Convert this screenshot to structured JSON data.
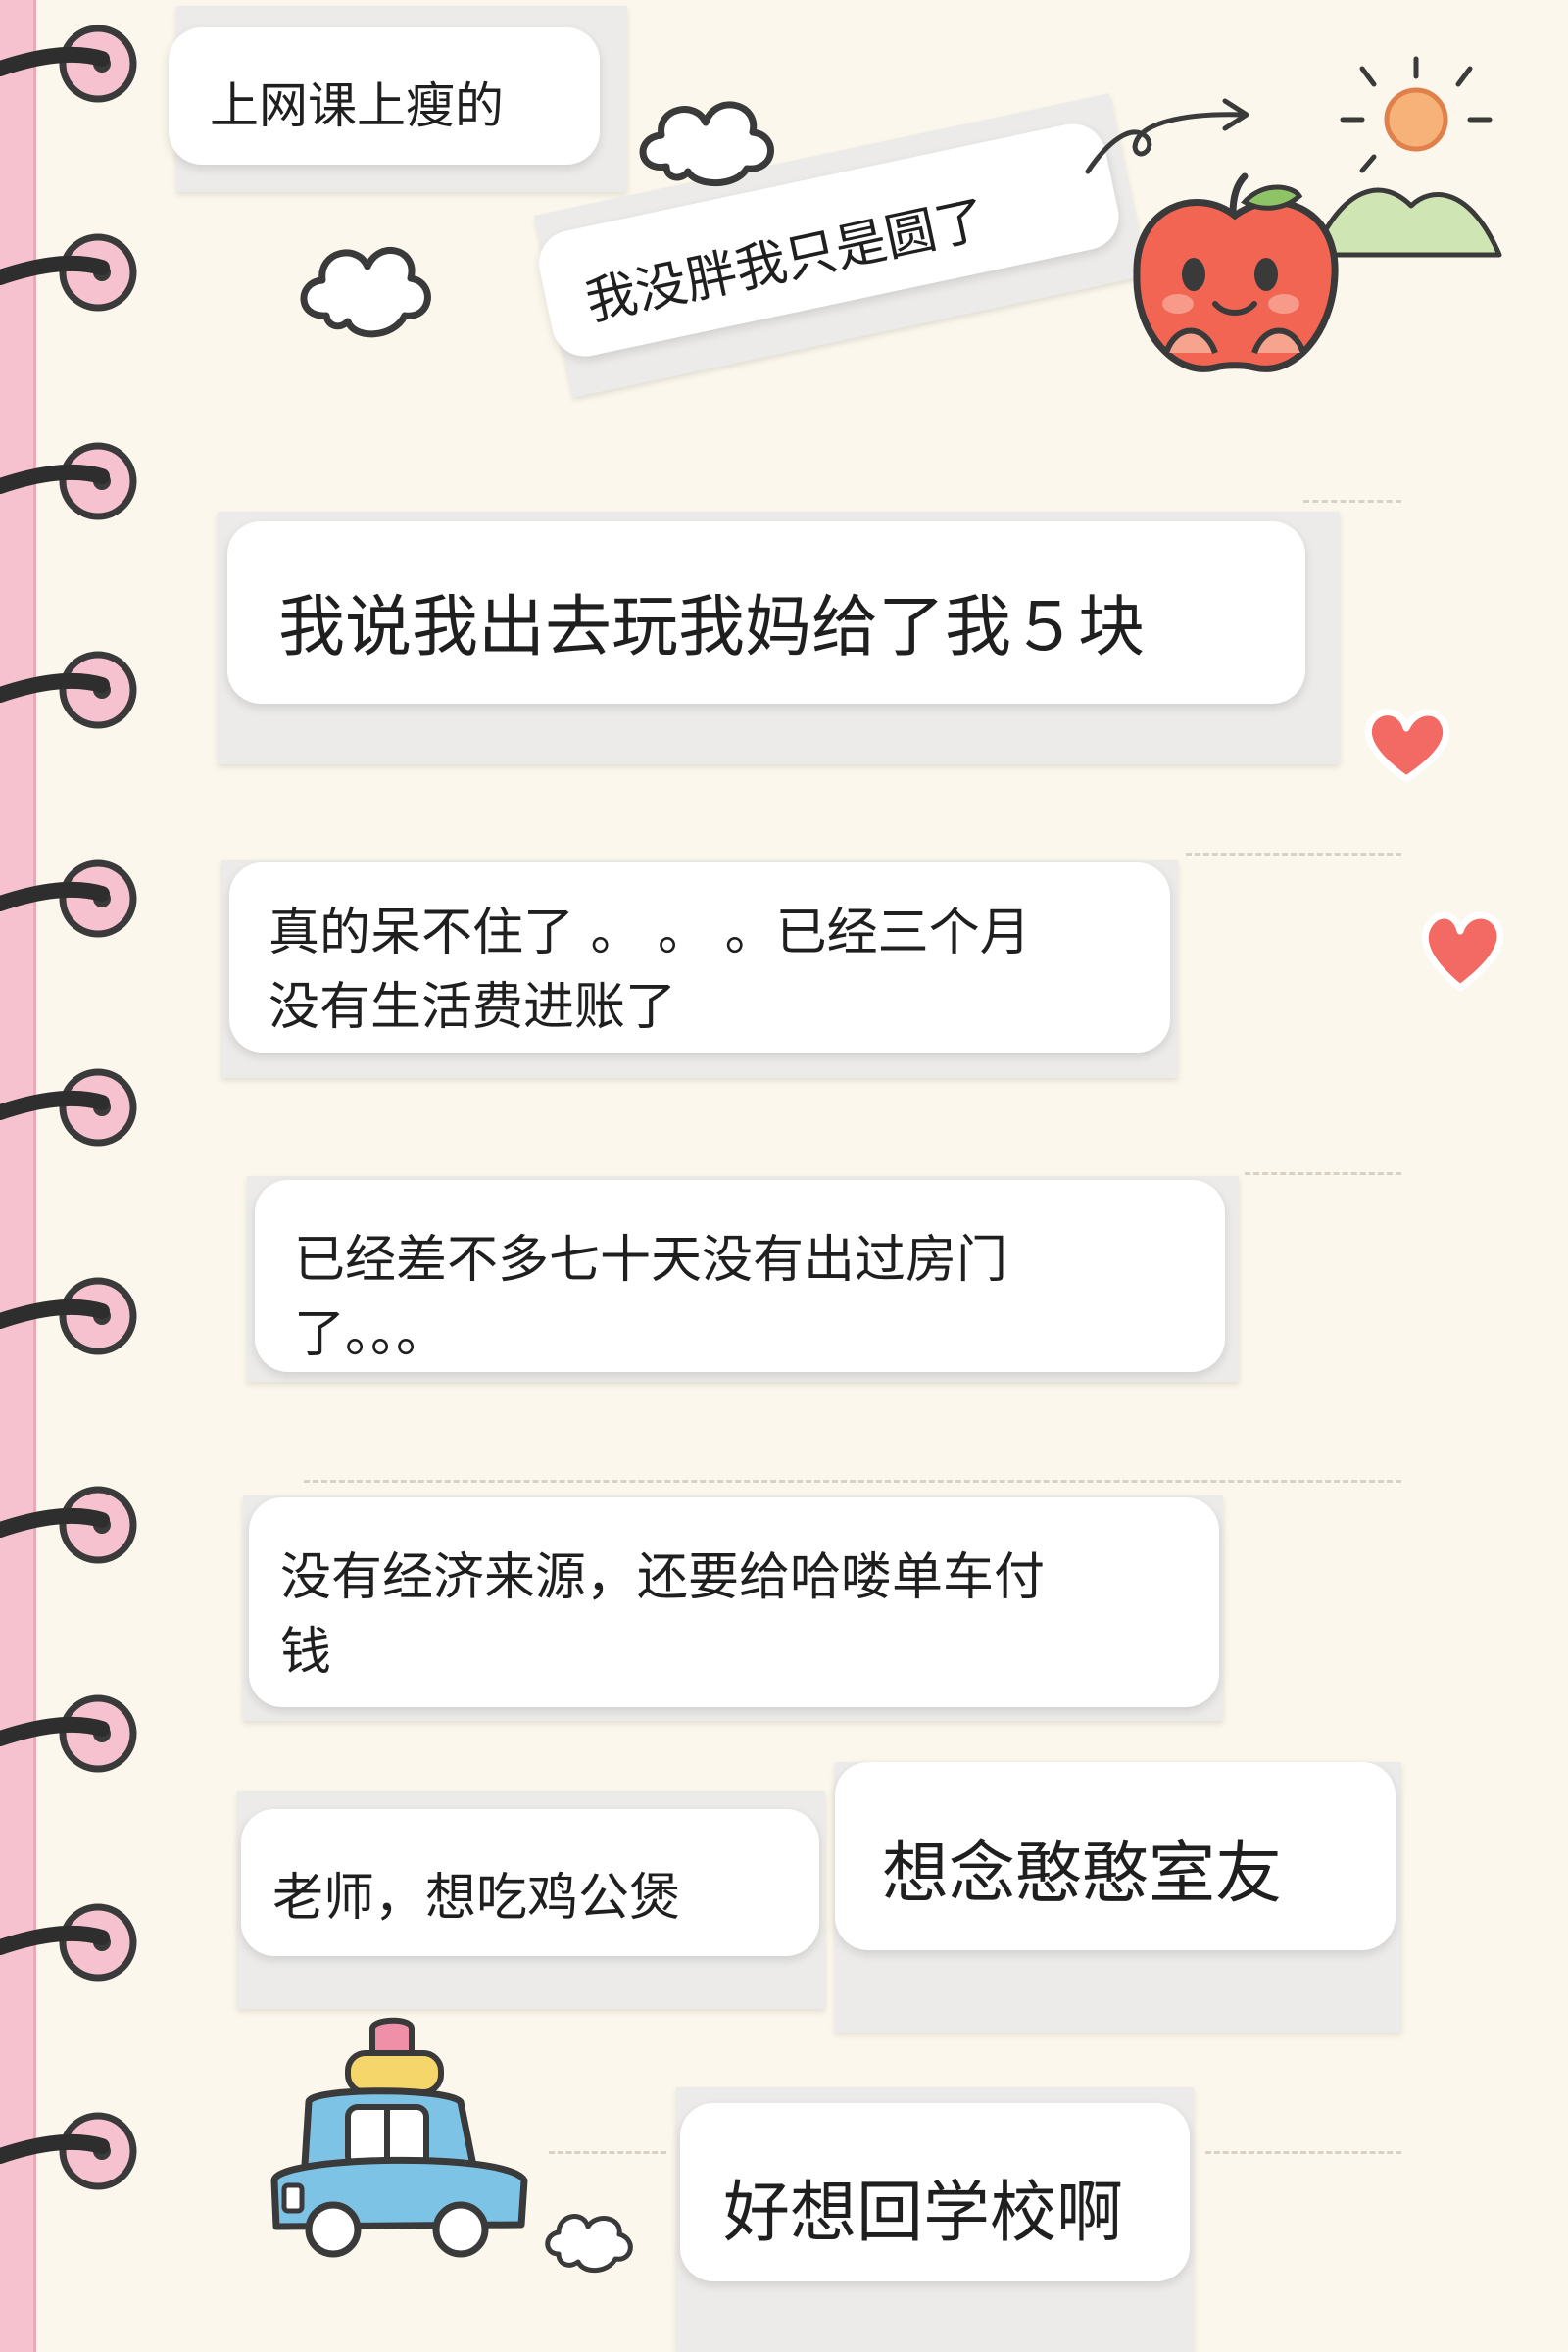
{
  "messages": [
    {
      "text": "上网课上瘦的"
    },
    {
      "text": "我没胖我只是圆了"
    },
    {
      "text": "我说我出去玩我妈给了我５块"
    },
    {
      "lines": [
        "真的呆不住了 。 。 。已经三个月",
        "没有生活费进账了"
      ]
    },
    {
      "lines": [
        "已经差不多七十天没有出过房门",
        "了。。。"
      ]
    },
    {
      "lines": [
        "没有经济来源，还要给哈喽单车付",
        "钱"
      ]
    },
    {
      "text": "老师，想吃鸡公煲"
    },
    {
      "text": "想念憨憨室友"
    },
    {
      "text": "好想回学校啊"
    }
  ],
  "decor": {
    "spine_color": "#f6c2cf",
    "ring_color": "#f6c2cf",
    "heart_color": "#f26a63",
    "sun_color": "#f3a15c",
    "apple_color": "#f26552",
    "car_color": "#7cc3e6",
    "icons": [
      "cloud-icon",
      "apple-icon",
      "sun-icon",
      "hill-icon",
      "heart-icon",
      "car-icon",
      "smoke-icon",
      "arrow-icon"
    ]
  }
}
